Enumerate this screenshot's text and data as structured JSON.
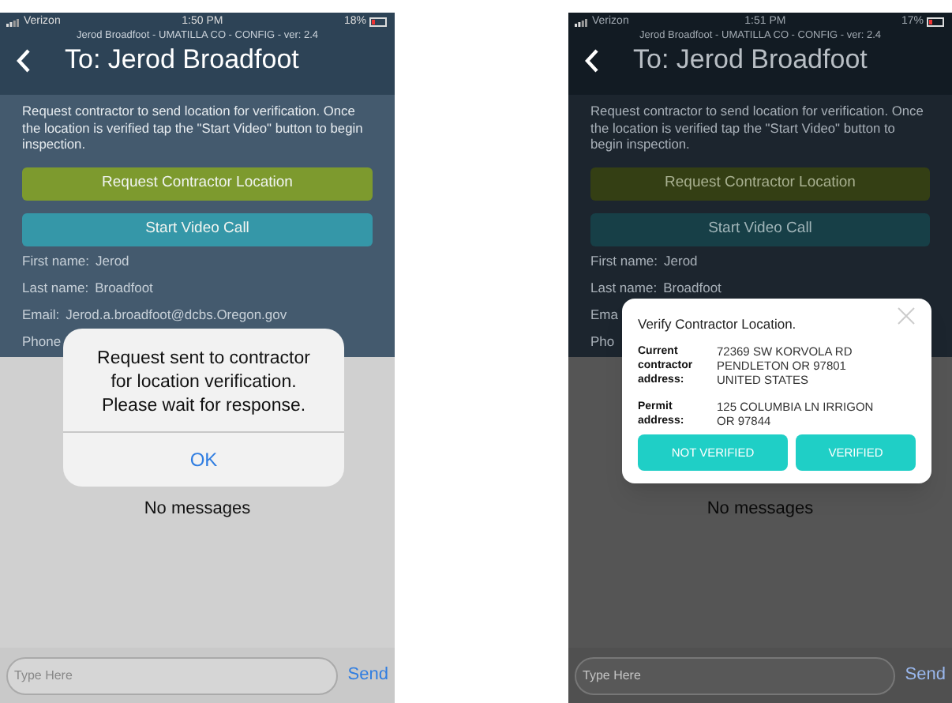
{
  "screens": [
    {
      "status_bar": {
        "carrier": "Verizon",
        "time": "1:50 PM",
        "battery": "18%"
      },
      "header": {
        "subtitle": "Jerod Broadfoot - UMATILLA CO - CONFIG - ver: 2.4",
        "title": "To: Jerod Broadfoot"
      },
      "instructions": "Request contractor to send location for verification. Once the location is verified tap the \"Start Video\" button to begin inspection.",
      "buttons": [
        {
          "label": "Request Contractor Location",
          "kind": "location"
        },
        {
          "label": "Start Video Call",
          "kind": "video"
        }
      ],
      "fields": [
        {
          "label": "First name:",
          "value": "Jerod"
        },
        {
          "label": "Last name:",
          "value": "Broadfoot"
        },
        {
          "label": "Email:",
          "value": "Jerod.a.broadfoot@dcbs.Oregon.gov"
        },
        {
          "label": "Phone"
        }
      ],
      "empty_text": "No messages",
      "composer": {
        "placeholder": "Type Here",
        "send": "Send"
      },
      "dimmed": false,
      "dialog": {
        "kind": "alert",
        "message": "Request sent to contractor for location verification. Please wait for response.",
        "button": "OK"
      }
    },
    {
      "status_bar": {
        "carrier": "Verizon",
        "time": "1:51 PM",
        "battery": "17%"
      },
      "header": {
        "subtitle": "Jerod Broadfoot - UMATILLA CO - CONFIG - ver: 2.4",
        "title": "To: Jerod Broadfoot"
      },
      "instructions": "Request contractor to send location for verification. Once the location is verified tap the \"Start Video\" button to begin inspection.",
      "buttons": [
        {
          "label": "Request Contractor Location",
          "kind": "location"
        },
        {
          "label": "Start Video Call",
          "kind": "video"
        }
      ],
      "fields": [
        {
          "label": "First name:",
          "value": "Jerod"
        },
        {
          "label": "Last name:",
          "value": "Broadfoot"
        },
        {
          "label": "Ema"
        },
        {
          "label": "Pho"
        }
      ],
      "empty_text": "No messages",
      "composer": {
        "placeholder": "Type Here",
        "send": "Send"
      },
      "dimmed": true,
      "dialog": {
        "kind": "verify",
        "title": "Verify Contractor Location.",
        "rows": [
          {
            "label": "Current contractor address:",
            "lines": [
              "72369 SW KORVOLA RD",
              "PENDLETON OR 97801",
              "UNITED STATES"
            ]
          },
          {
            "label": "Permit address:",
            "lines": [
              "125 COLUMBIA LN IRRIGON",
              "OR 97844"
            ]
          }
        ],
        "buttons": [
          "NOT VERIFIED",
          "VERIFIED"
        ]
      }
    }
  ]
}
